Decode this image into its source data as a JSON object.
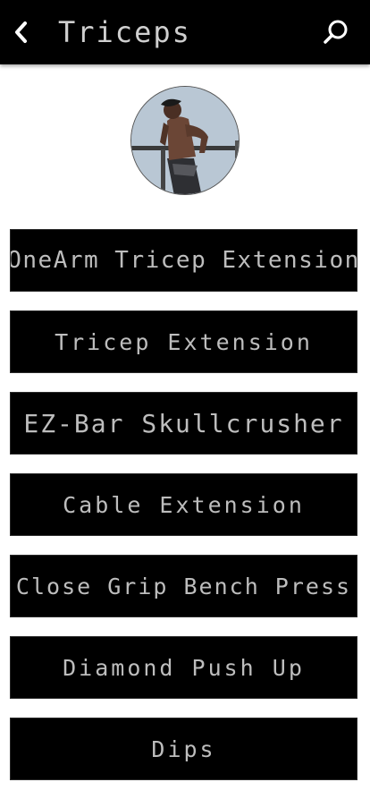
{
  "header": {
    "title": "Triceps",
    "back_icon": "chevron-left-icon",
    "search_icon": "search-icon"
  },
  "colors": {
    "app_bar": "#000000",
    "button_bg": "#000000",
    "text": "#bdbdbd",
    "background": "#ffffff"
  },
  "exercises": [
    {
      "label": "OneArm Tricep Extension"
    },
    {
      "label": "Tricep Extension"
    },
    {
      "label": "EZ-Bar Skullcrusher"
    },
    {
      "label": "Cable Extension"
    },
    {
      "label": "Close Grip Bench Press"
    },
    {
      "label": "Diamond Push Up"
    },
    {
      "label": "Dips"
    }
  ]
}
